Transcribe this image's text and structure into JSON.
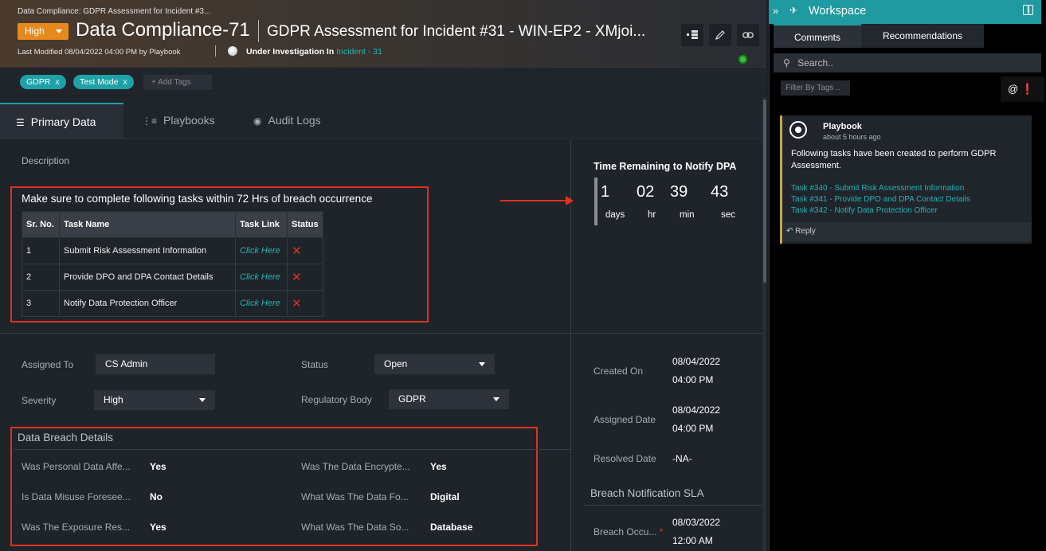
{
  "header": {
    "breadcrumb": "Data Compliance: GDPR Assessment for Incident #3...",
    "severity": "High",
    "record_id": "Data Compliance-71",
    "subtitle": "GDPR Assessment for Incident #31 - WIN-EP2 - XMjoi...",
    "last_modified": "Last Modified 08/04/2022 04:00 PM by Playbook",
    "under_investigation": "Under Investigation In",
    "incident_link": "Incident - 31"
  },
  "tags": {
    "items": [
      "GDPR",
      "Test Mode"
    ],
    "add_placeholder": "+ Add Tags"
  },
  "tabs": [
    "Primary Data",
    "Playbooks",
    "Audit Logs"
  ],
  "description": {
    "label": "Description",
    "heading": "Make sure to complete following tasks within 72 Hrs of breach occurrence",
    "columns": [
      "Sr. No.",
      "Task Name",
      "Task Link",
      "Status"
    ],
    "rows": [
      {
        "no": "1",
        "name": "Submit Risk Assessment Information",
        "link": "Click Here",
        "status": "✕"
      },
      {
        "no": "2",
        "name": "Provide DPO and DPA Contact Details",
        "link": "Click Here",
        "status": "✕"
      },
      {
        "no": "3",
        "name": "Notify Data Protection Officer",
        "link": "Click Here",
        "status": "✕"
      }
    ]
  },
  "timer": {
    "title": "Time Remaining to Notify DPA",
    "values": [
      "1",
      "02",
      "39",
      "43"
    ],
    "units": [
      "days",
      "hr",
      "min",
      "sec"
    ]
  },
  "fields": {
    "assigned_to_label": "Assigned To",
    "assigned_to": "CS Admin",
    "status_label": "Status",
    "status": "Open",
    "severity_label": "Severity",
    "severity": "High",
    "regulatory_label": "Regulatory Body",
    "regulatory": "GDPR"
  },
  "breach": {
    "title": "Data Breach Details",
    "items": [
      {
        "label": "Was Personal Data Affe...",
        "value": "Yes"
      },
      {
        "label": "Was The Data Encrypte...",
        "value": "Yes"
      },
      {
        "label": "Is Data Misuse Foresee...",
        "value": "No"
      },
      {
        "label": "What Was The Data Fo...",
        "value": "Digital"
      },
      {
        "label": "Was The Exposure Res...",
        "value": "Yes"
      },
      {
        "label": "What Was The Data So...",
        "value": "Database"
      }
    ]
  },
  "dates": {
    "created_label": "Created On",
    "created_date": "08/04/2022",
    "created_time": "04:00 PM",
    "assigned_label": "Assigned Date",
    "assigned_date": "08/04/2022",
    "assigned_time": "04:00 PM",
    "resolved_label": "Resolved Date",
    "resolved": "-NA-",
    "sla_title": "Breach Notification SLA",
    "breach_occ_label": "Breach Occu...",
    "breach_occ_date": "08/03/2022",
    "breach_occ_time": "12:00 AM"
  },
  "workspace": {
    "title": "Workspace",
    "tabs": [
      "Comments",
      "Recommendations"
    ],
    "search_placeholder": "Search..",
    "filter_placeholder": "Filter By Tags ..",
    "icons": "@ ❗",
    "comment": {
      "author": "Playbook",
      "time": "about 5 hours ago",
      "body": "Following tasks have been created to perform GDPR Assessment.",
      "links": [
        "Task #340 - Submit Risk Assessment Information",
        "Task #341 - Provide DPO and DPA Contact Details",
        "Task #342 - Notify Data Protection Officer"
      ],
      "reply": "Reply"
    }
  },
  "colors": {
    "accent": "#1ea2a8",
    "severity_high": "#e68a1e",
    "annotation_red": "#e0321f",
    "link": "#24b3b3"
  }
}
